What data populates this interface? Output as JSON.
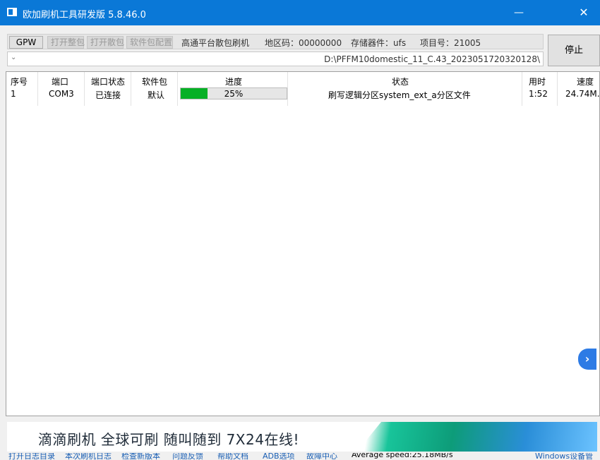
{
  "window": {
    "title": "欧加刷机工具研发版 5.8.46.0",
    "minimize_icon": "minimize-icon",
    "close_icon": "close-icon"
  },
  "toolbar": {
    "gpw_label": "GPW",
    "open_full_label": "打开整包",
    "open_scatter_label": "打开散包",
    "software_config_label": "软件包配置",
    "mode_text": "高通平台散包刷机",
    "region_text": "地区码：00000000",
    "storage_text": "存储器件：ufs",
    "project_text": "项目号：21005"
  },
  "path": {
    "value": "D:\\PFFM10domestic_11_C.43_2023051720320128\\"
  },
  "stop_label": "停止",
  "table": {
    "headers": {
      "index": "序号",
      "port": "端口",
      "port_status": "端口状态",
      "package": "软件包",
      "progress": "进度",
      "status": "状态",
      "elapsed": "用时",
      "speed": "速度"
    },
    "rows": [
      {
        "index": "1",
        "port": "COM3",
        "port_status": "已连接",
        "package": "默认",
        "progress_value": 0.25,
        "progress_text": "25%",
        "status": "刷写逻辑分区system_ext_a分区文件",
        "elapsed": "1:52",
        "speed": "24.74M..."
      }
    ]
  },
  "banner": {
    "text": "滴滴刷机 全球可刷 随叫随到 7X24在线!"
  },
  "bottom_links": [
    {
      "label": "打开日志目录"
    },
    {
      "label": "本次刷机日志"
    },
    {
      "label": "检查新版本"
    },
    {
      "label": "问题反馈"
    },
    {
      "label": "帮助文档"
    },
    {
      "label": "ADB选项"
    },
    {
      "label": "故障中心"
    }
  ],
  "bottom_status": "Average speed:25.18MB/s",
  "bottom_right": "Windows设备管",
  "colors": {
    "titlebar": "#0a78d7",
    "progress_fill": "#06b025",
    "link": "#1a5fb4"
  }
}
